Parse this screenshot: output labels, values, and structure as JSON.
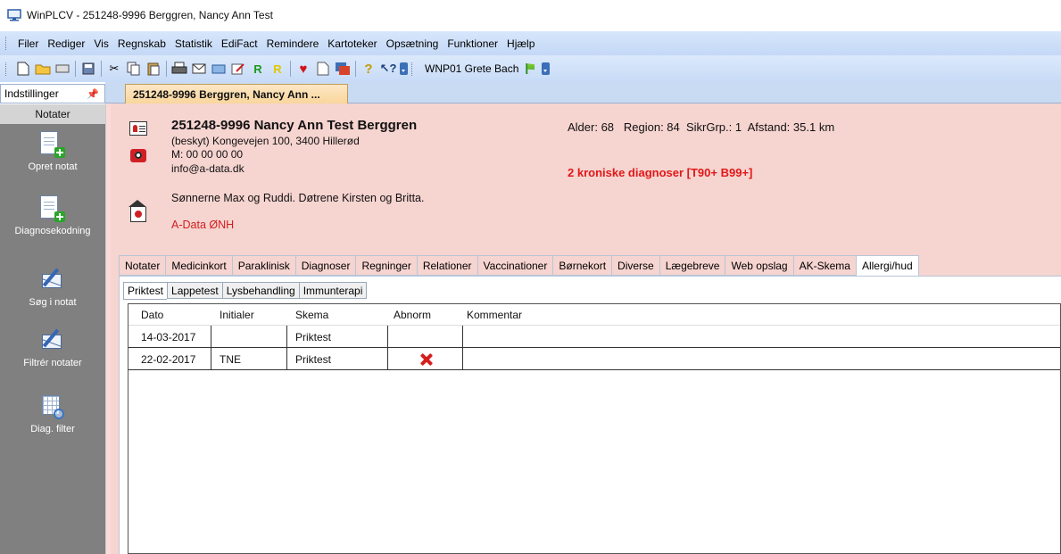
{
  "window": {
    "title": "WinPLCV - 251248-9996 Berggren, Nancy Ann Test"
  },
  "menu": [
    "Filer",
    "Rediger",
    "Vis",
    "Regnskab",
    "Statistik",
    "EdiFact",
    "Remindere",
    "Kartoteker",
    "Opsætning",
    "Funktioner",
    "Hjælp"
  ],
  "toolbar": {
    "user": "WNP01 Grete Bach"
  },
  "sidebar": {
    "header": "Indstillinger",
    "section": "Notater",
    "buttons": [
      {
        "label": "Opret notat",
        "icon": "new-note-icon"
      },
      {
        "label": "Diagnosekodning",
        "icon": "diagnosis-coding-icon"
      },
      {
        "label": "Søg i notat",
        "icon": "search-note-icon"
      },
      {
        "label": "Filtrér notater",
        "icon": "filter-notes-icon"
      },
      {
        "label": "Diag. filter",
        "icon": "diag-filter-icon"
      }
    ]
  },
  "doc_tab": "251248-9996 Berggren, Nancy Ann ...",
  "patient": {
    "name": "251248-9996 Nancy Ann Test Berggren",
    "address": "(beskyt) Kongevejen 100, 3400 Hillerød",
    "phone": "M: 00 00 00 00",
    "email": "info@a-data.dk",
    "relations": "Sønnerne Max og Ruddi. Døtrene Kirsten og Britta.",
    "clinic": "A-Data ØNH",
    "stats": "Alder: 68   Region: 84  SikrGrp.: 1  Afstand: 35.1 km",
    "chronic": "2 kroniske diagnoser [T90+ B99+]"
  },
  "tabs": [
    "Notater",
    "Medicinkort",
    "Paraklinisk",
    "Diagnoser",
    "Regninger",
    "Relationer",
    "Vaccinationer",
    "Børnekort",
    "Diverse",
    "Lægebreve",
    "Web opslag",
    "AK-Skema",
    "Allergi/hud"
  ],
  "subtabs": [
    "Priktest",
    "Lappetest",
    "Lysbehandling",
    "Immunterapi"
  ],
  "table": {
    "columns": [
      "Dato",
      "Initialer",
      "Skema",
      "Abnorm",
      "Kommentar"
    ],
    "rows": [
      {
        "dato": "14-03-2017",
        "initialer": "",
        "skema": "Priktest",
        "abnorm": false,
        "kommentar": ""
      },
      {
        "dato": "22-02-2017",
        "initialer": "TNE",
        "skema": "Priktest",
        "abnorm": true,
        "kommentar": ""
      }
    ]
  }
}
